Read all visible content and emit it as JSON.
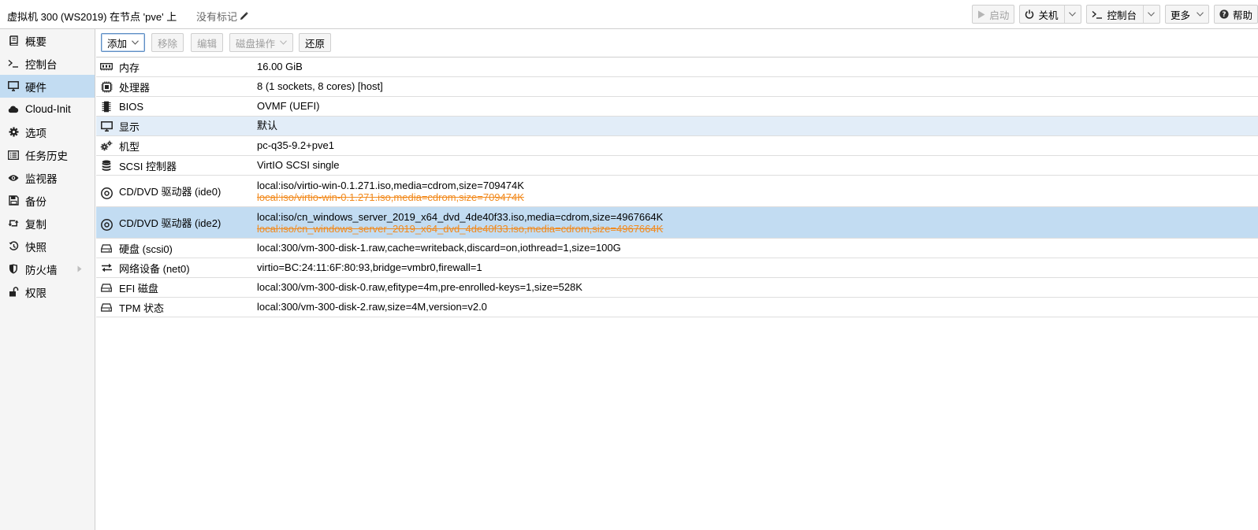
{
  "header": {
    "vm_title": "虚拟机 300 (WS2019) 在节点 'pve' 上",
    "tags_label": "没有标记",
    "buttons": {
      "start": "启动",
      "shutdown": "关机",
      "console": "控制台",
      "more": "更多",
      "help": "帮助"
    }
  },
  "sidebar": {
    "items": [
      {
        "label": "概要",
        "icon": "book-icon"
      },
      {
        "label": "控制台",
        "icon": "terminal-icon"
      },
      {
        "label": "硬件",
        "icon": "desktop-icon",
        "active": true
      },
      {
        "label": "Cloud-Init",
        "icon": "cloud-icon"
      },
      {
        "label": "选项",
        "icon": "gear-icon"
      },
      {
        "label": "任务历史",
        "icon": "list-icon"
      },
      {
        "label": "监视器",
        "icon": "eye-icon"
      },
      {
        "label": "备份",
        "icon": "floppy-icon"
      },
      {
        "label": "复制",
        "icon": "retweet-icon"
      },
      {
        "label": "快照",
        "icon": "history-icon"
      },
      {
        "label": "防火墙",
        "icon": "shield-icon"
      },
      {
        "label": "权限",
        "icon": "unlock-icon"
      }
    ]
  },
  "toolbar": {
    "add": "添加",
    "remove": "移除",
    "edit": "编辑",
    "disk_action": "磁盘操作",
    "revert": "还原"
  },
  "hardware": {
    "rows": [
      {
        "key": "内存",
        "value": "16.00 GiB",
        "icon": "memory-icon"
      },
      {
        "key": "处理器",
        "value": "8 (1 sockets, 8 cores) [host]",
        "icon": "cpu-icon"
      },
      {
        "key": "BIOS",
        "value": "OVMF (UEFI)",
        "icon": "microchip-icon"
      },
      {
        "key": "显示",
        "value": "默认",
        "icon": "monitor-icon"
      },
      {
        "key": "机型",
        "value": "pc-q35-9.2+pve1",
        "icon": "cogs-icon"
      },
      {
        "key": "SCSI 控制器",
        "value": "VirtIO SCSI single",
        "icon": "database-icon"
      },
      {
        "key": "CD/DVD 驱动器 (ide0)",
        "value": "local:iso/virtio-win-0.1.271.iso,media=cdrom,size=709474K",
        "pending": "local:iso/virtio-win-0.1.271.iso,media=cdrom,size=709474K",
        "icon": "cdrom-icon"
      },
      {
        "key": "CD/DVD 驱动器 (ide2)",
        "value": "local:iso/cn_windows_server_2019_x64_dvd_4de40f33.iso,media=cdrom,size=4967664K",
        "pending": "local:iso/cn_windows_server_2019_x64_dvd_4de40f33.iso,media=cdrom,size=4967664K",
        "icon": "cdrom-icon"
      },
      {
        "key": "硬盘 (scsi0)",
        "value": "local:300/vm-300-disk-1.raw,cache=writeback,discard=on,iothread=1,size=100G",
        "icon": "hdd-icon"
      },
      {
        "key": "网络设备 (net0)",
        "value": "virtio=BC:24:11:6F:80:93,bridge=vmbr0,firewall=1",
        "icon": "exchange-icon"
      },
      {
        "key": "EFI 磁盘",
        "value": "local:300/vm-300-disk-0.raw,efitype=4m,pre-enrolled-keys=1,size=528K",
        "icon": "hdd-icon"
      },
      {
        "key": "TPM 状态",
        "value": "local:300/vm-300-disk-2.raw,size=4M,version=v2.0",
        "icon": "hdd-icon"
      }
    ]
  }
}
